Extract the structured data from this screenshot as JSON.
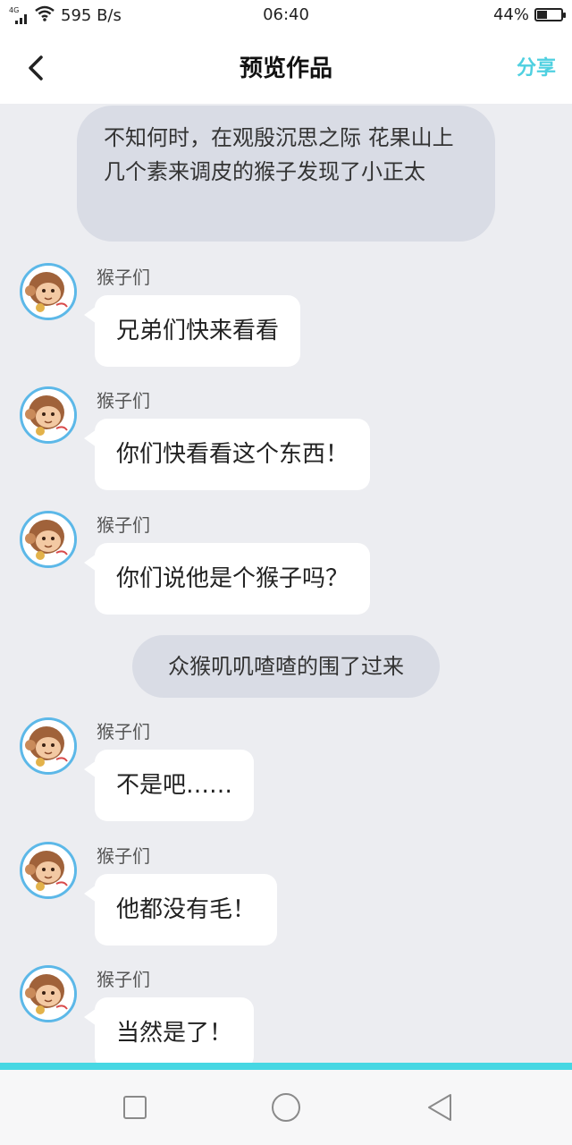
{
  "status_bar": {
    "network_type": "4G",
    "speed": "595 B/s",
    "time": "06:40",
    "battery_level": "44%",
    "battery_fraction": 0.44
  },
  "header": {
    "title": "预览作品",
    "share_label": "分享",
    "back_icon": "chevron-left-icon"
  },
  "narrations": [
    "不知何时，在观殷沉思之际 花果山上几个素来调皮的猴子发现了小正太",
    "众猴叽叽喳喳的围了过来"
  ],
  "messages": [
    {
      "sender": "猴子们",
      "text": "兄弟们快来看看"
    },
    {
      "sender": "猴子们",
      "text": "你们快看看这个东西！"
    },
    {
      "sender": "猴子们",
      "text": "你们说他是个猴子吗？"
    },
    {
      "sender": "猴子们",
      "text": "不是吧……"
    },
    {
      "sender": "猴子们",
      "text": "他都没有毛！"
    },
    {
      "sender": "猴子们",
      "text": "当然是了！"
    }
  ],
  "colors": {
    "accent": "#4fd0e0",
    "avatar_border": "#5cb8e8",
    "chat_background": "#ecedf1",
    "narration_background": "#d9dce5"
  }
}
